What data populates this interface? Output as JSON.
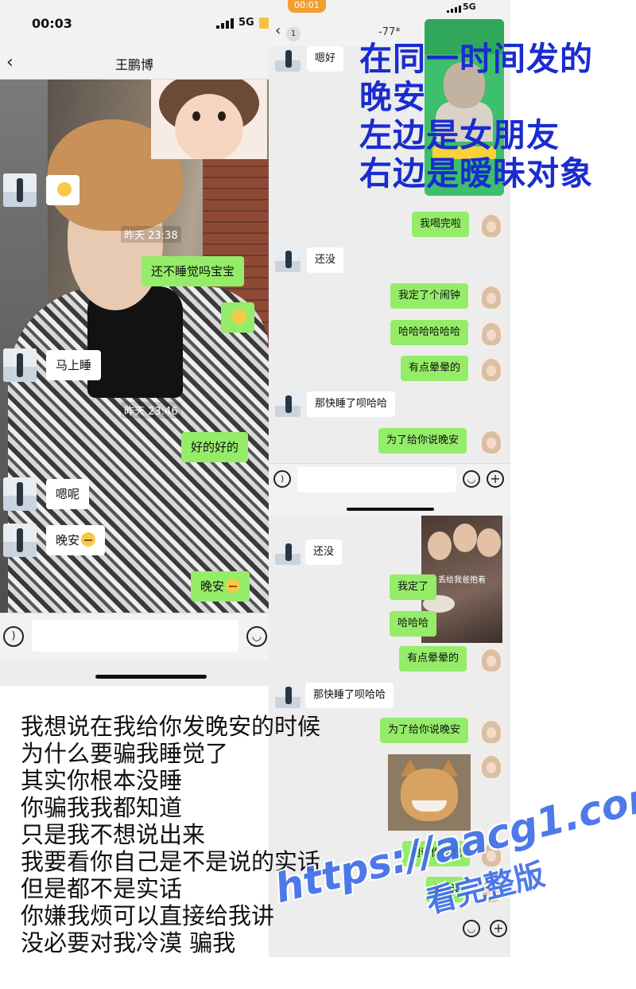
{
  "left": {
    "status_time": "00:03",
    "network": "5G",
    "contact_name": "王鹏博",
    "timestamps": [
      "昨天 23:38",
      "昨天 23:46"
    ],
    "messages": [
      {
        "side": "recv",
        "text": ""
      },
      {
        "side": "sent",
        "text": "还不睡觉吗宝宝"
      },
      {
        "side": "sent",
        "text": ""
      },
      {
        "side": "recv",
        "text": "马上睡"
      },
      {
        "side": "sent",
        "text": "好的好的"
      },
      {
        "side": "recv",
        "text": "嗯呢"
      },
      {
        "side": "recv",
        "text": "晚安"
      },
      {
        "side": "sent",
        "text": "晚安"
      }
    ]
  },
  "right_top": {
    "status_time": "00:01",
    "network": "5G",
    "unread_count": "1",
    "contact_name": "-77*",
    "messages": [
      {
        "side": "recv",
        "text": "嗯好"
      },
      {
        "side": "sent",
        "text": "我喝完啦"
      },
      {
        "side": "recv",
        "text": "还没"
      },
      {
        "side": "sent",
        "text": "我定了个闹钟"
      },
      {
        "side": "sent",
        "text": "哈哈哈哈哈哈"
      },
      {
        "side": "sent",
        "text": "有点晕晕的"
      },
      {
        "side": "recv",
        "text": "那快睡了呗哈哈"
      },
      {
        "side": "sent",
        "text": "为了给你说晚安"
      }
    ]
  },
  "right_bottom": {
    "meme_caption": "丢给我爸抱着",
    "messages": [
      {
        "side": "recv",
        "text": "还没"
      },
      {
        "side": "sent",
        "text": "我定了"
      },
      {
        "side": "sent",
        "text": "哈哈哈"
      },
      {
        "side": "sent",
        "text": "有点晕晕的"
      },
      {
        "side": "recv",
        "text": "那快睡了呗哈哈"
      },
      {
        "side": "sent",
        "text": "为了给你说晚安"
      },
      {
        "side": "sent",
        "text": "谢谢你等我"
      },
      {
        "side": "sent",
        "text": "晚安o"
      }
    ]
  },
  "overlay_caption": [
    "在同一时间发的",
    "晚安",
    "左边是女朋友",
    "右边是暧昧对象"
  ],
  "bottom_text": [
    "我想说在我给你发晚安的时候",
    "为什么要骗我睡觉了",
    "其实你根本没睡",
    "你骗我我都知道",
    "只是我不想说出来",
    "我要看你自己是不是说的实话",
    "但是都不是实话",
    "你嫌我烦可以直接给我讲",
    "没必要对我冷漠 骗我"
  ],
  "watermark": {
    "url": "https://aacg1.com",
    "subtitle": "看完整版"
  },
  "colors": {
    "sent_bubble": "#95ec69",
    "recv_bubble": "#ffffff",
    "chat_bg": "#ededed",
    "overlay_text": "#1a2ccf",
    "watermark": "#3f6fe8"
  }
}
